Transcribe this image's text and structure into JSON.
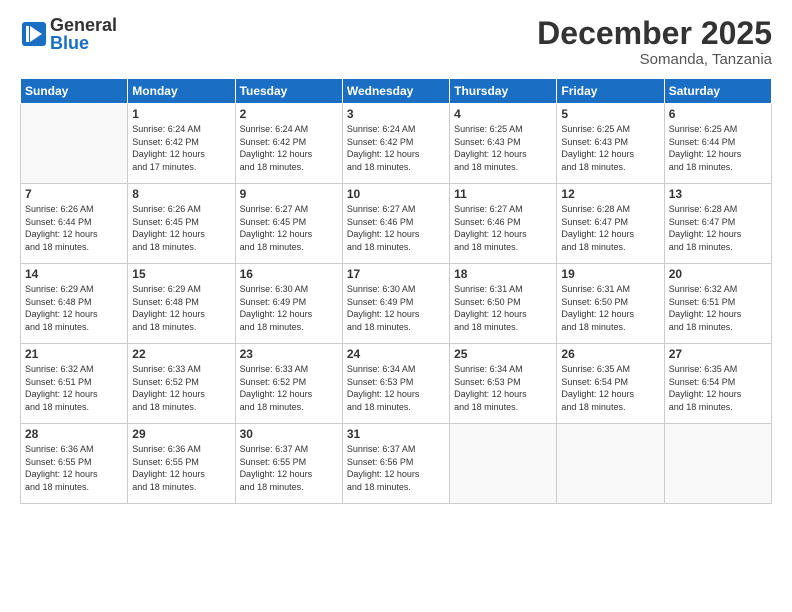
{
  "logo": {
    "general": "General",
    "blue": "Blue"
  },
  "title": "December 2025",
  "subtitle": "Somanda, Tanzania",
  "days_of_week": [
    "Sunday",
    "Monday",
    "Tuesday",
    "Wednesday",
    "Thursday",
    "Friday",
    "Saturday"
  ],
  "weeks": [
    [
      {
        "num": "",
        "info": ""
      },
      {
        "num": "1",
        "info": "Sunrise: 6:24 AM\nSunset: 6:42 PM\nDaylight: 12 hours\nand 17 minutes."
      },
      {
        "num": "2",
        "info": "Sunrise: 6:24 AM\nSunset: 6:42 PM\nDaylight: 12 hours\nand 18 minutes."
      },
      {
        "num": "3",
        "info": "Sunrise: 6:24 AM\nSunset: 6:42 PM\nDaylight: 12 hours\nand 18 minutes."
      },
      {
        "num": "4",
        "info": "Sunrise: 6:25 AM\nSunset: 6:43 PM\nDaylight: 12 hours\nand 18 minutes."
      },
      {
        "num": "5",
        "info": "Sunrise: 6:25 AM\nSunset: 6:43 PM\nDaylight: 12 hours\nand 18 minutes."
      },
      {
        "num": "6",
        "info": "Sunrise: 6:25 AM\nSunset: 6:44 PM\nDaylight: 12 hours\nand 18 minutes."
      }
    ],
    [
      {
        "num": "7",
        "info": "Sunrise: 6:26 AM\nSunset: 6:44 PM\nDaylight: 12 hours\nand 18 minutes."
      },
      {
        "num": "8",
        "info": "Sunrise: 6:26 AM\nSunset: 6:45 PM\nDaylight: 12 hours\nand 18 minutes."
      },
      {
        "num": "9",
        "info": "Sunrise: 6:27 AM\nSunset: 6:45 PM\nDaylight: 12 hours\nand 18 minutes."
      },
      {
        "num": "10",
        "info": "Sunrise: 6:27 AM\nSunset: 6:46 PM\nDaylight: 12 hours\nand 18 minutes."
      },
      {
        "num": "11",
        "info": "Sunrise: 6:27 AM\nSunset: 6:46 PM\nDaylight: 12 hours\nand 18 minutes."
      },
      {
        "num": "12",
        "info": "Sunrise: 6:28 AM\nSunset: 6:47 PM\nDaylight: 12 hours\nand 18 minutes."
      },
      {
        "num": "13",
        "info": "Sunrise: 6:28 AM\nSunset: 6:47 PM\nDaylight: 12 hours\nand 18 minutes."
      }
    ],
    [
      {
        "num": "14",
        "info": "Sunrise: 6:29 AM\nSunset: 6:48 PM\nDaylight: 12 hours\nand 18 minutes."
      },
      {
        "num": "15",
        "info": "Sunrise: 6:29 AM\nSunset: 6:48 PM\nDaylight: 12 hours\nand 18 minutes."
      },
      {
        "num": "16",
        "info": "Sunrise: 6:30 AM\nSunset: 6:49 PM\nDaylight: 12 hours\nand 18 minutes."
      },
      {
        "num": "17",
        "info": "Sunrise: 6:30 AM\nSunset: 6:49 PM\nDaylight: 12 hours\nand 18 minutes."
      },
      {
        "num": "18",
        "info": "Sunrise: 6:31 AM\nSunset: 6:50 PM\nDaylight: 12 hours\nand 18 minutes."
      },
      {
        "num": "19",
        "info": "Sunrise: 6:31 AM\nSunset: 6:50 PM\nDaylight: 12 hours\nand 18 minutes."
      },
      {
        "num": "20",
        "info": "Sunrise: 6:32 AM\nSunset: 6:51 PM\nDaylight: 12 hours\nand 18 minutes."
      }
    ],
    [
      {
        "num": "21",
        "info": "Sunrise: 6:32 AM\nSunset: 6:51 PM\nDaylight: 12 hours\nand 18 minutes."
      },
      {
        "num": "22",
        "info": "Sunrise: 6:33 AM\nSunset: 6:52 PM\nDaylight: 12 hours\nand 18 minutes."
      },
      {
        "num": "23",
        "info": "Sunrise: 6:33 AM\nSunset: 6:52 PM\nDaylight: 12 hours\nand 18 minutes."
      },
      {
        "num": "24",
        "info": "Sunrise: 6:34 AM\nSunset: 6:53 PM\nDaylight: 12 hours\nand 18 minutes."
      },
      {
        "num": "25",
        "info": "Sunrise: 6:34 AM\nSunset: 6:53 PM\nDaylight: 12 hours\nand 18 minutes."
      },
      {
        "num": "26",
        "info": "Sunrise: 6:35 AM\nSunset: 6:54 PM\nDaylight: 12 hours\nand 18 minutes."
      },
      {
        "num": "27",
        "info": "Sunrise: 6:35 AM\nSunset: 6:54 PM\nDaylight: 12 hours\nand 18 minutes."
      }
    ],
    [
      {
        "num": "28",
        "info": "Sunrise: 6:36 AM\nSunset: 6:55 PM\nDaylight: 12 hours\nand 18 minutes."
      },
      {
        "num": "29",
        "info": "Sunrise: 6:36 AM\nSunset: 6:55 PM\nDaylight: 12 hours\nand 18 minutes."
      },
      {
        "num": "30",
        "info": "Sunrise: 6:37 AM\nSunset: 6:55 PM\nDaylight: 12 hours\nand 18 minutes."
      },
      {
        "num": "31",
        "info": "Sunrise: 6:37 AM\nSunset: 6:56 PM\nDaylight: 12 hours\nand 18 minutes."
      },
      {
        "num": "",
        "info": ""
      },
      {
        "num": "",
        "info": ""
      },
      {
        "num": "",
        "info": ""
      }
    ]
  ]
}
